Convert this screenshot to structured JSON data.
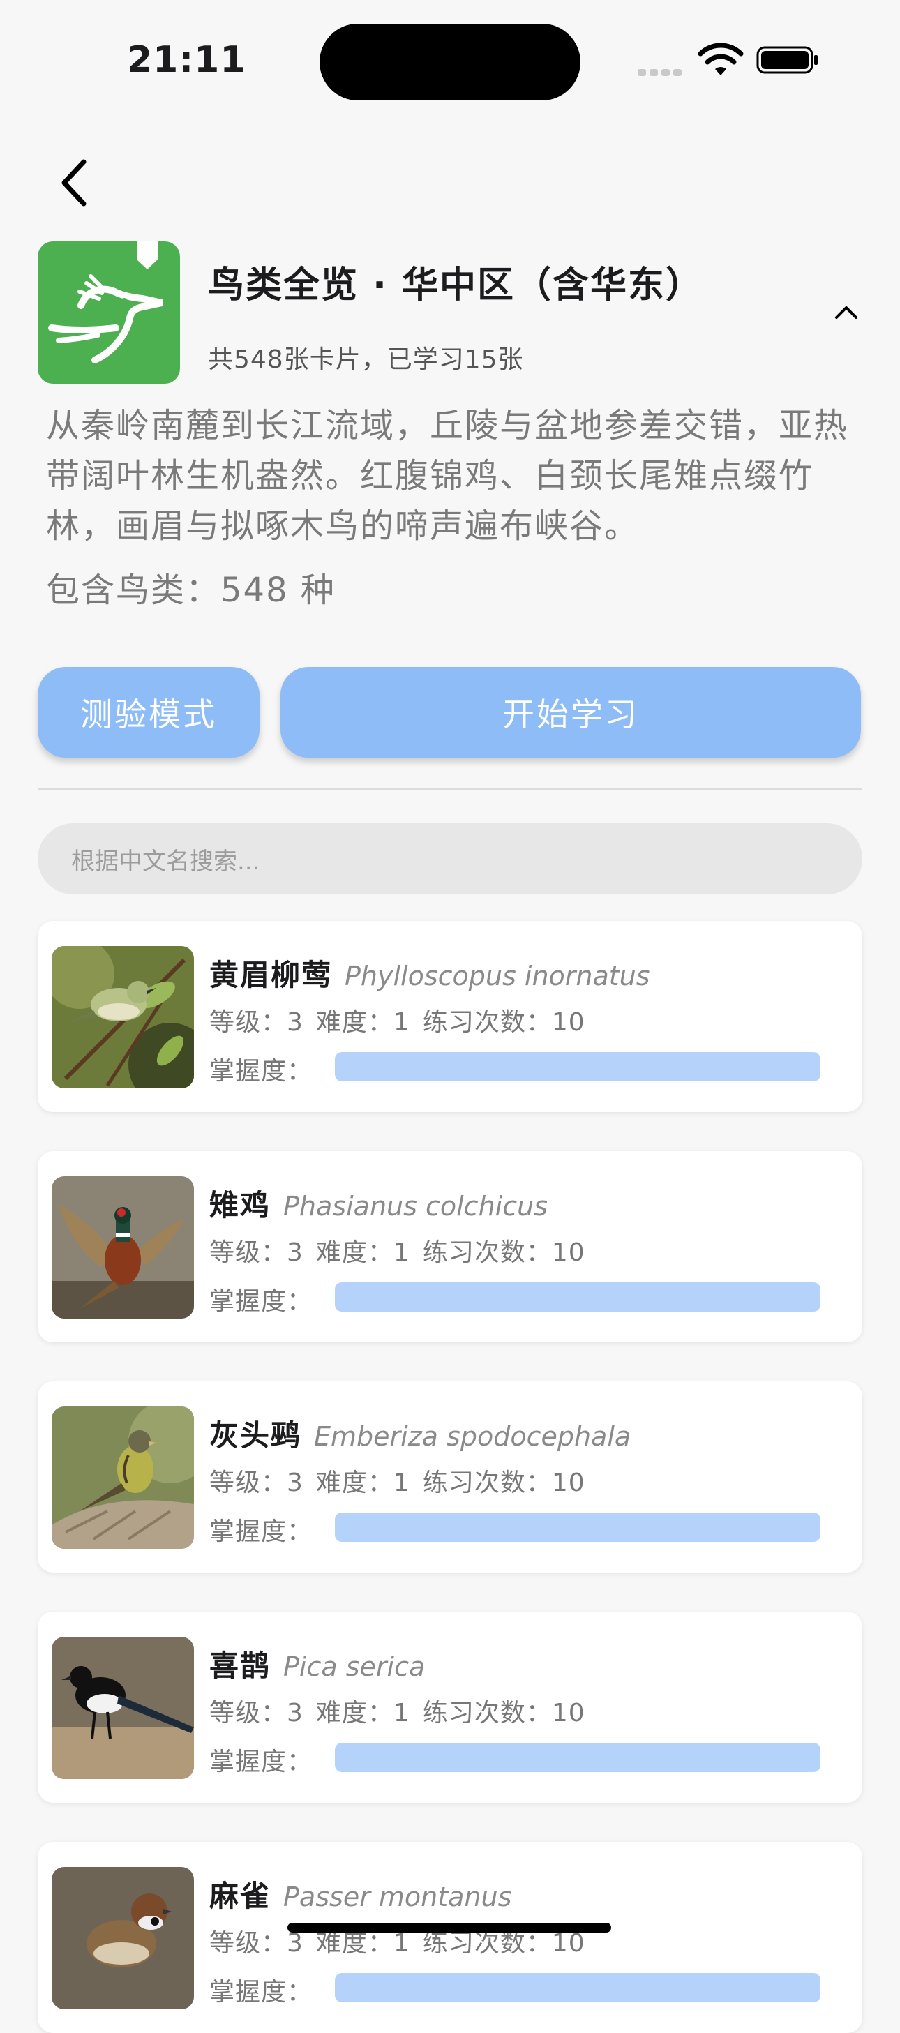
{
  "status_bar": {
    "time": "21:11"
  },
  "header": {
    "title": "鸟类全览 · 华中区（含华东）",
    "subtitle": "共548张卡片，已学习15张",
    "description": "从秦岭南麓到长江流域，丘陵与盆地参差交错，亚热带阔叶林生机盎然。红腹锦鸡、白颈长尾雉点缀竹林，画眉与拟啄木鸟的啼声遍布峡谷。",
    "species_count": "包含鸟类：548 种"
  },
  "buttons": {
    "quiz": "测验模式",
    "start": "开始学习"
  },
  "search": {
    "placeholder": "根据中文名搜索..."
  },
  "labels": {
    "mastery": "掌握度："
  },
  "birds": [
    {
      "name": "黄眉柳莺",
      "latin": "Phylloscopus inornatus",
      "level": "等级：3",
      "difficulty": "难度：1",
      "practice": "练习次数：10",
      "mastery": 0
    },
    {
      "name": "雉鸡",
      "latin": "Phasianus colchicus",
      "level": "等级：3",
      "difficulty": "难度：1",
      "practice": "练习次数：10",
      "mastery": 0
    },
    {
      "name": "灰头鹀",
      "latin": "Emberiza spodocephala",
      "level": "等级：3",
      "difficulty": "难度：1",
      "practice": "练习次数：10",
      "mastery": 0
    },
    {
      "name": "喜鹊",
      "latin": "Pica serica",
      "level": "等级：3",
      "difficulty": "难度：1",
      "practice": "练习次数：10",
      "mastery": 0
    },
    {
      "name": "麻雀",
      "latin": "Passer montanus",
      "level": "等级：3",
      "difficulty": "难度：1",
      "practice": "练习次数：10",
      "mastery": 0
    }
  ],
  "colors": {
    "accent": "#8ebcf7",
    "bar_track": "#b5d3fa",
    "app_icon": "#4caf50"
  }
}
